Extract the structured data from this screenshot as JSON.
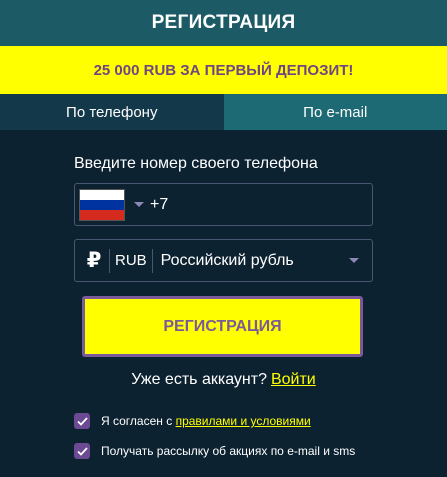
{
  "header": {
    "title": "РЕГИСТРАЦИЯ"
  },
  "promo": {
    "text": "25 000 RUB ЗА ПЕРВЫЙ ДЕПОЗИТ!"
  },
  "tabs": [
    {
      "label": "По телефону",
      "active": true
    },
    {
      "label": "По e-mail",
      "active": false
    }
  ],
  "phone": {
    "label": "Введите номер своего телефона",
    "country_flag": "russia-flag",
    "value": "+7"
  },
  "currency": {
    "icon": "ruble-icon",
    "code": "RUB",
    "name": "Российский рубль"
  },
  "submit": {
    "label": "РЕГИСТРАЦИЯ"
  },
  "login": {
    "prompt": "Уже есть аккаунт?",
    "link": "Войти"
  },
  "consents": {
    "terms_text": "Я согласен с",
    "terms_link": "правилами и условиями",
    "newsletter_text": "Получать рассылку об акциях по e-mail и sms"
  },
  "colors": {
    "background": "#0d2231",
    "header": "#1c5b66",
    "accent_yellow": "#ffff00",
    "accent_purple": "#7a5a9a"
  }
}
